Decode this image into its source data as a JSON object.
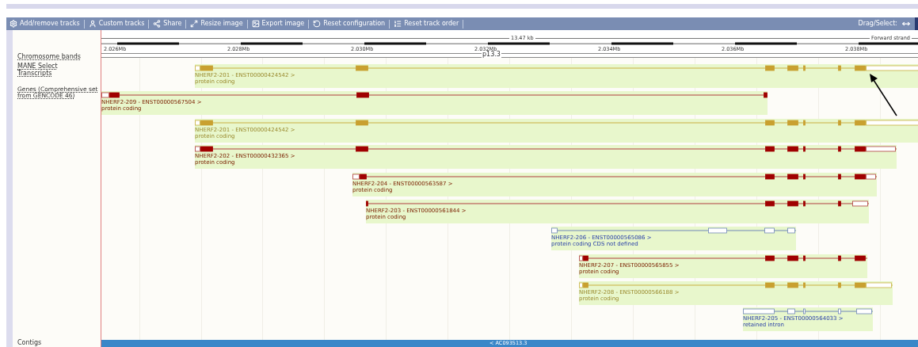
{
  "toolbar": {
    "buttons": [
      {
        "kind": "tracks",
        "label": "Add/remove tracks"
      },
      {
        "kind": "custom",
        "label": "Custom tracks"
      },
      {
        "kind": "share",
        "label": "Share"
      },
      {
        "kind": "resize",
        "label": "Resize image"
      },
      {
        "kind": "export",
        "label": "Export image"
      },
      {
        "kind": "reset",
        "label": "Reset configuration"
      },
      {
        "kind": "order",
        "label": "Reset track order"
      }
    ],
    "drag_select": "Drag/Select:"
  },
  "ruler": {
    "length": "13.47 kb",
    "strand": "Forward strand",
    "ticks": [
      "2.026Mb",
      "2.028Mb",
      "2.030Mb",
      "2.032Mb",
      "2.034Mb",
      "2.036Mb",
      "2.038Mb"
    ],
    "band": "p13.3"
  },
  "track_labels": [
    "Chromosome bands",
    "MANE Select Transcripts",
    "Genes (Comprehensive set from GENCODE 46)"
  ],
  "transcripts": [
    {
      "kind": "mane",
      "label": "NHERF2-201 - ENST00000424542 >",
      "biotype": "protein coding"
    },
    {
      "kind": "coding",
      "label": "NHERF2-209 - ENST00000567504 >",
      "biotype": "protein coding"
    },
    {
      "kind": "mane",
      "label": "NHERF2-201 - ENST00000424542 >",
      "biotype": "protein coding"
    },
    {
      "kind": "coding",
      "label": "NHERF2-202 - ENST00000432365 >",
      "biotype": "protein coding"
    },
    {
      "kind": "coding",
      "label": "NHERF2-204 - ENST00000563587 >",
      "biotype": "protein coding"
    },
    {
      "kind": "coding",
      "label": "NHERF2-203 - ENST00000561844 >",
      "biotype": "protein coding"
    },
    {
      "kind": "noncoding",
      "label": "NHERF2-206 - ENST00000565086 >",
      "biotype": "protein coding CDS not defined"
    },
    {
      "kind": "coding",
      "label": "NHERF2-207 - ENST00000565855 >",
      "biotype": "protein coding"
    },
    {
      "kind": "mane",
      "label": "NHERF2-208 - ENST00000566188 >",
      "biotype": "protein coding"
    },
    {
      "kind": "noncoding",
      "label": "NHERF2-205 - ENST00000564033 >",
      "biotype": "retained intron"
    }
  ],
  "contigs": {
    "label": "Contigs",
    "contig": "< AC093513.3"
  }
}
